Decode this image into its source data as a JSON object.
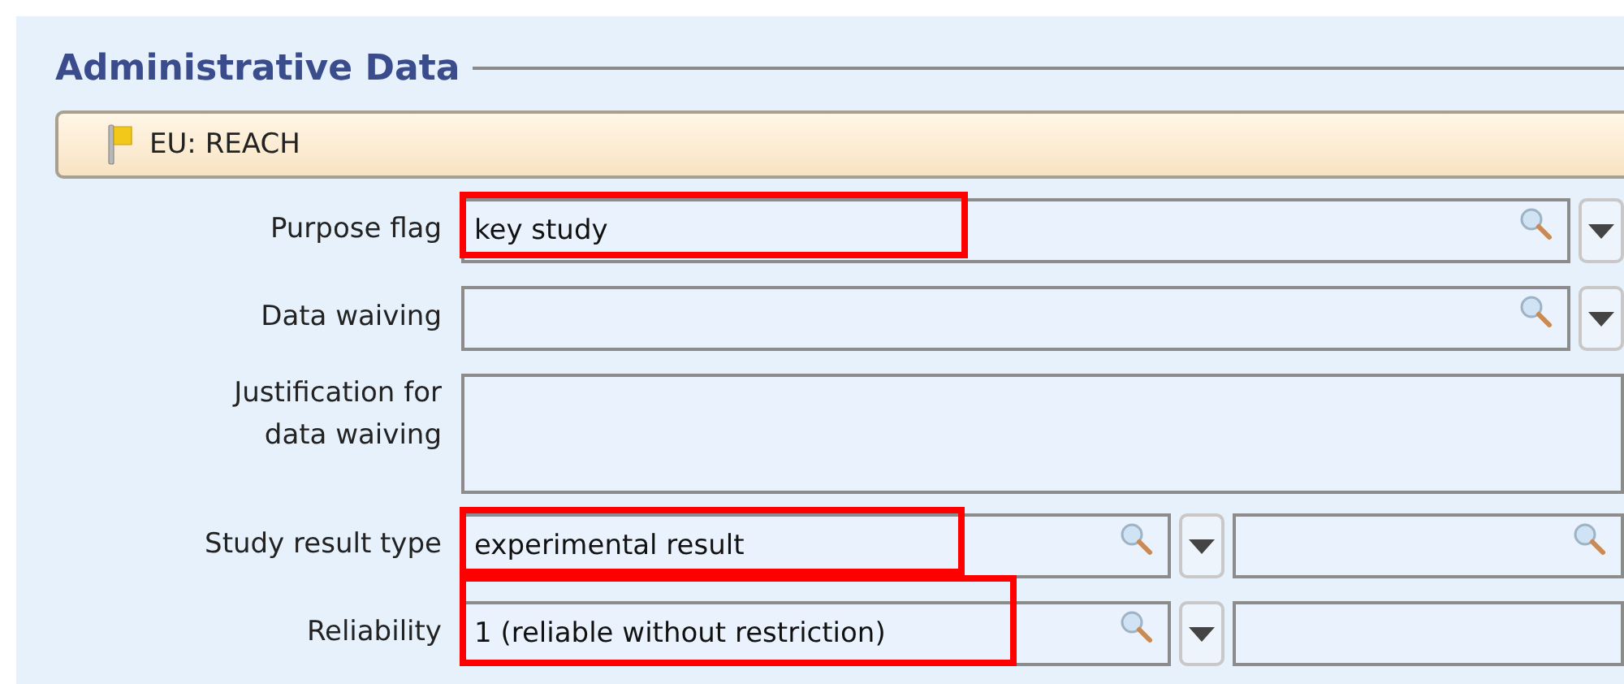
{
  "section": {
    "title": "Administrative Data"
  },
  "group": {
    "title": "EU: REACH"
  },
  "rows": [
    {
      "label": "Purpose flag",
      "kind": "picklist",
      "value": "key study",
      "highlighted": true
    },
    {
      "label": "Data waiving",
      "kind": "picklist",
      "highlighted": false
    },
    {
      "label": "Justification for data waiving",
      "kind": "textarea",
      "highlighted": false
    },
    {
      "label": "Study result type",
      "kind": "picklist-pair",
      "value": "experimental result",
      "highlighted": true
    },
    {
      "label": "Reliability",
      "kind": "picklist-text",
      "value": "1 (reliable without restriction)",
      "highlighted": true
    }
  ]
}
